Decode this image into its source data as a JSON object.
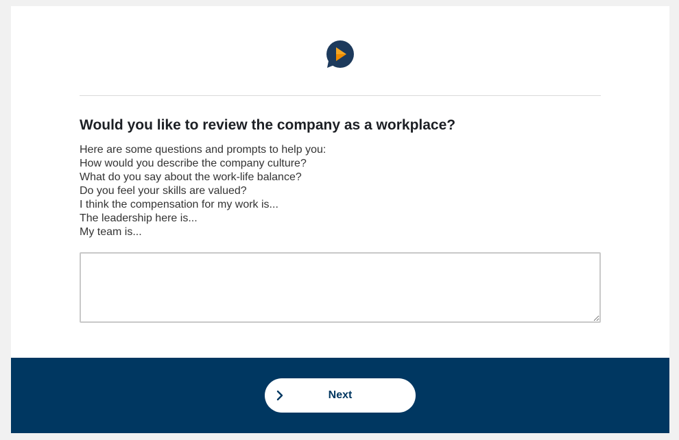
{
  "logo": {
    "icon": "chat-bubble-play-icon",
    "colors": {
      "bubble": "#1d3a5c",
      "play": "#f5a623"
    }
  },
  "question": {
    "title": "Would you like to review the company as a workplace?",
    "prompts": [
      "Here are some questions and prompts to help you:",
      "How would you describe the company culture?",
      "What do you say about the work-life balance?",
      "Do you feel your skills are valued?",
      "I think the compensation for my work is...",
      "The leadership here is...",
      "My team is..."
    ],
    "answer_value": ""
  },
  "footer": {
    "background": "#003761",
    "next_label": "Next",
    "next_icon": "chevron-right-icon"
  }
}
